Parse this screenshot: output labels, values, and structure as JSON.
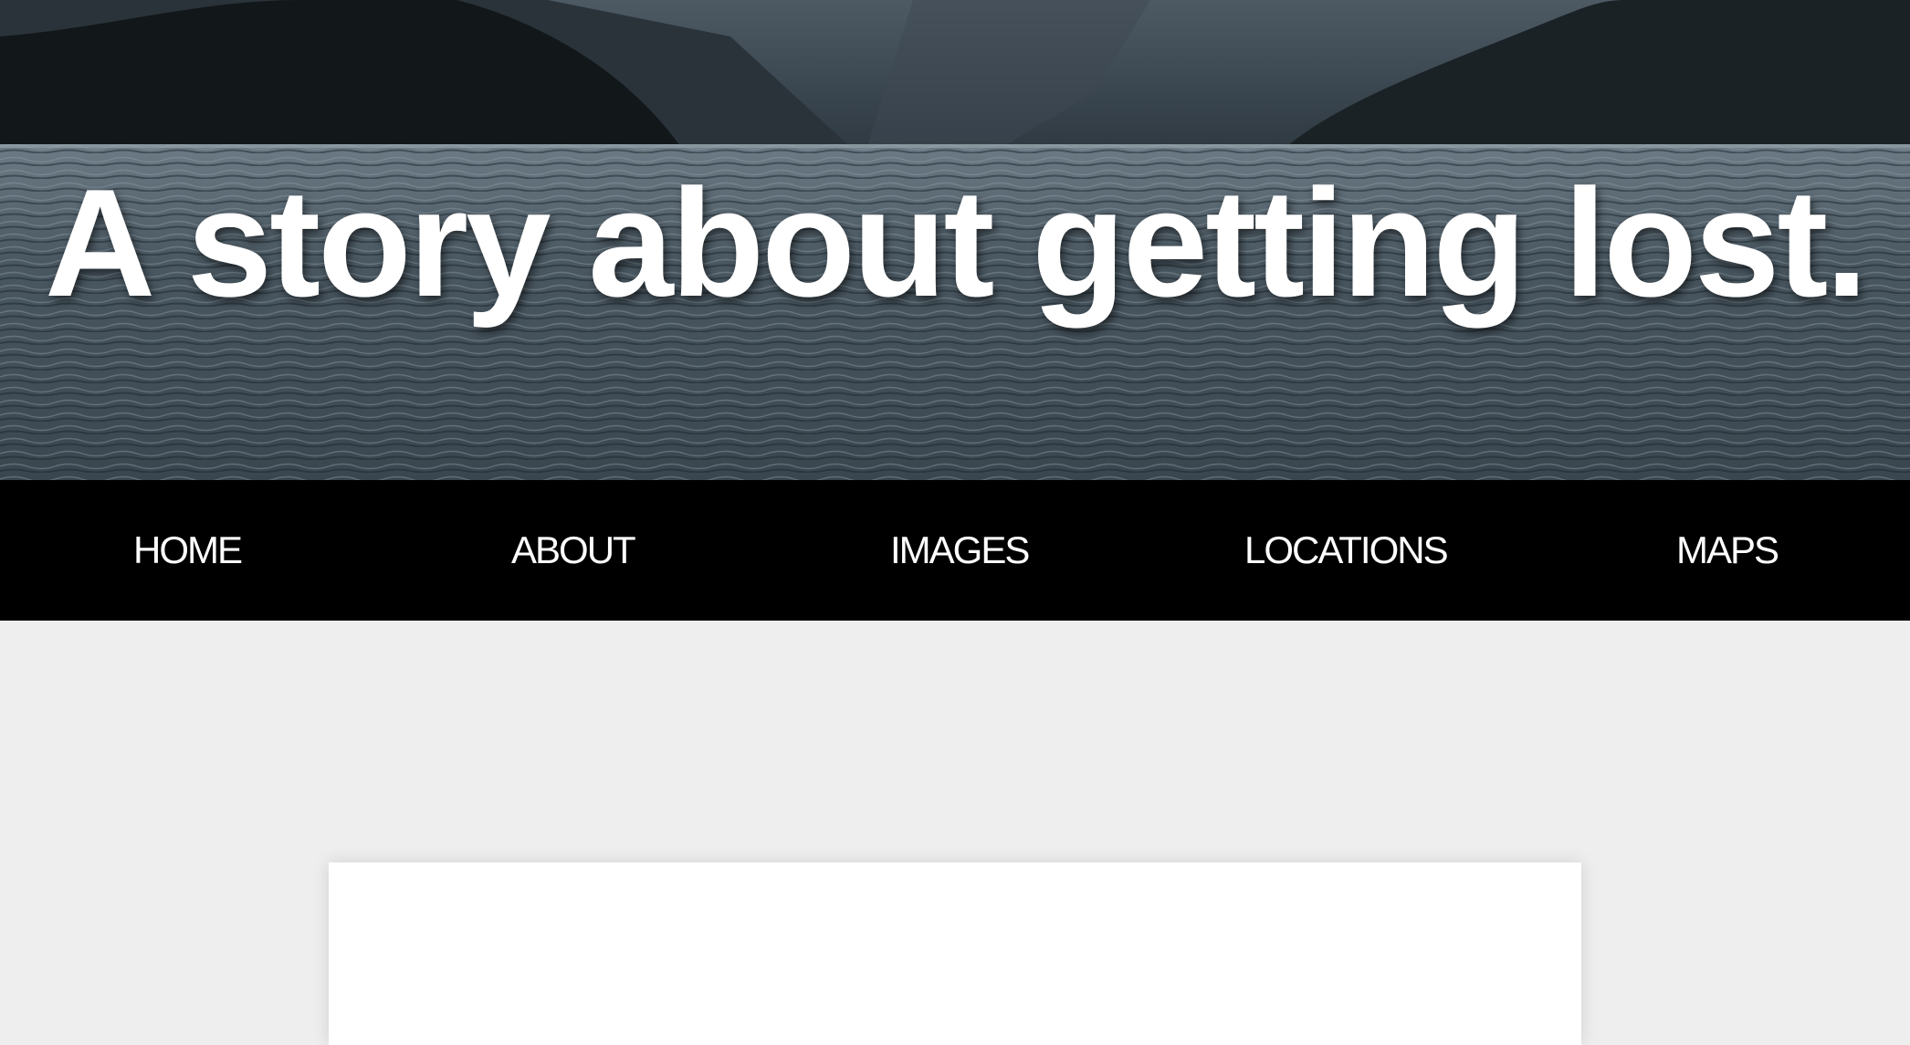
{
  "hero": {
    "title": "A story about getting lost.",
    "image": "dark-lake-with-mountains"
  },
  "nav": {
    "items": [
      {
        "label": "HOME"
      },
      {
        "label": "ABOUT"
      },
      {
        "label": "IMAGES"
      },
      {
        "label": "LOCATIONS"
      },
      {
        "label": "MAPS"
      }
    ]
  },
  "colors": {
    "nav_background": "#000000",
    "nav_text": "#ffffff",
    "page_background": "#eeeeee",
    "card_background": "#ffffff",
    "title_text": "#ffffff"
  }
}
